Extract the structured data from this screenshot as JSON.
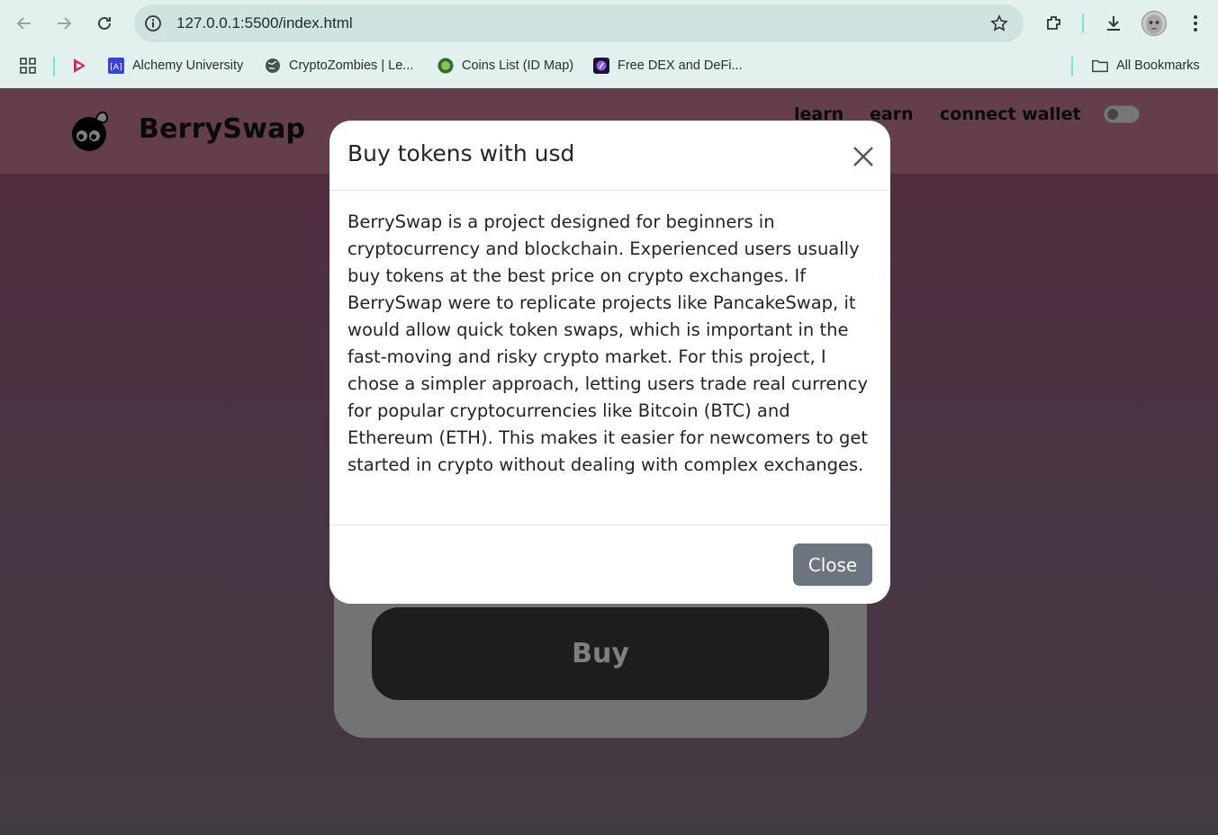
{
  "browser": {
    "url": "127.0.0.1:5500/index.html",
    "bookmarks": [
      {
        "label": "Alchemy University",
        "icon": "alchemy-icon"
      },
      {
        "label": "CryptoZombies | Le...",
        "icon": "globe-icon"
      },
      {
        "label": "Coins List (ID Map)",
        "icon": "coin-icon"
      },
      {
        "label": "Free DEX and DeFi...",
        "icon": "dex-icon"
      }
    ],
    "all_bookmarks_label": "All Bookmarks",
    "accent": "#7fe0d4"
  },
  "site": {
    "brand": "BerrySwap",
    "nav": {
      "learn": "learn",
      "earn": "earn",
      "connect_wallet": "connect wallet"
    },
    "buy_button": "Buy",
    "header_color": "#c87c9a"
  },
  "modal": {
    "title": "Buy tokens with usd",
    "body": "BerrySwap is a project designed for beginners in cryptocurrency and blockchain. Experienced users usually buy tokens at the best price on crypto exchanges. If BerrySwap were to replicate projects like PancakeSwap, it would allow quick token swaps, which is important in the fast-moving and risky crypto market. For this project, I chose a simpler approach, letting users trade real currency for popular cryptocurrencies like Bitcoin (BTC) and Ethereum (ETH). This makes it easier for newcomers to get started in crypto without dealing with complex exchanges.",
    "close_label": "Close",
    "close_color": "#6c757d"
  }
}
